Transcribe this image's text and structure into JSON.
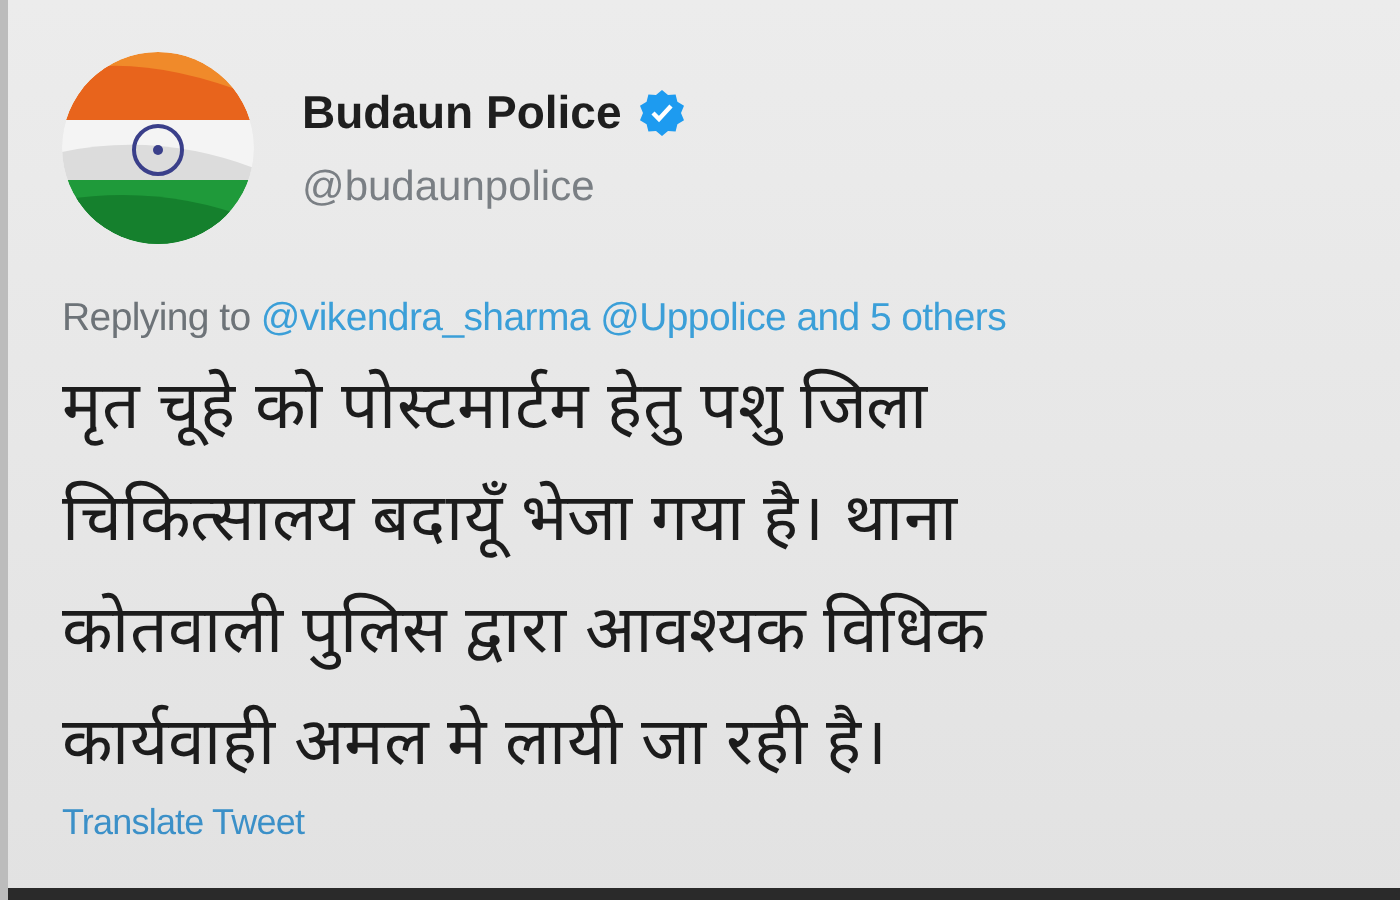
{
  "author": {
    "name": "Budaun Police",
    "verified": true,
    "handle": "@budaunpolice"
  },
  "reply": {
    "prefix": "Replying to",
    "links": [
      "@vikendra_sharma",
      "@Uppolice",
      "and 5 others"
    ]
  },
  "tweet_lines": [
    "मृत चूहे को पोस्टमार्टम हेतु पशु जिला",
    "चिकित्सालय बदायूँ भेजा गया है। थाना",
    "कोतवाली पुलिस द्वारा आवश्यक विधिक",
    "कार्यवाही अमल मे लायी जा रही है।"
  ],
  "translate_link": "Translate Tweet"
}
